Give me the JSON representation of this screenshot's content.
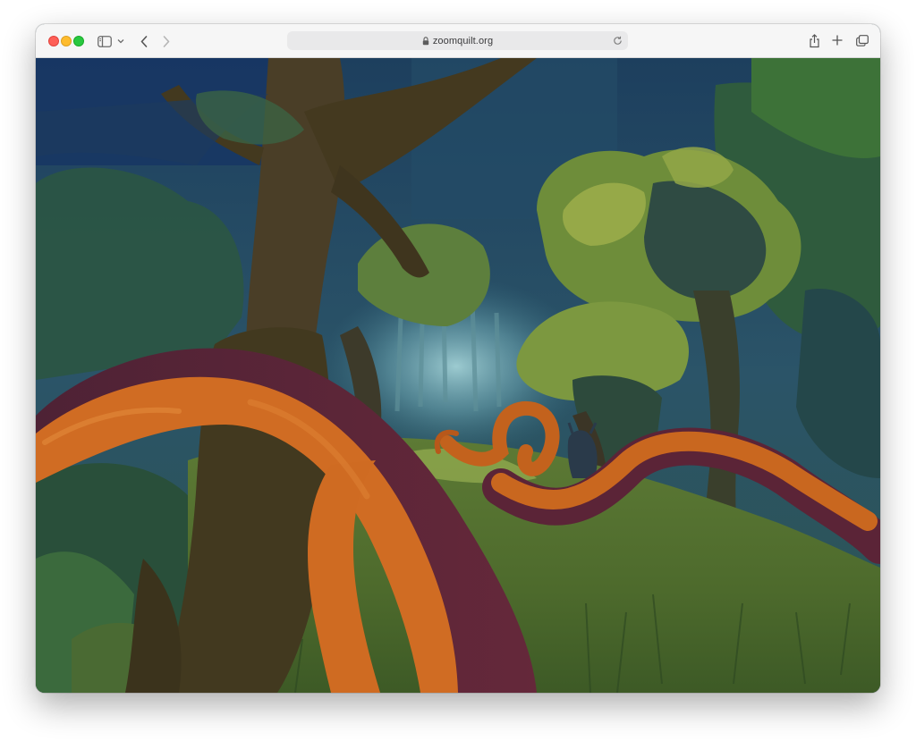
{
  "browser": {
    "url": "zoomquilt.org",
    "icons": {
      "close": "traffic-light-close",
      "minimize": "traffic-light-minimize",
      "maximize": "traffic-light-maximize",
      "sidebar": "sidebar-icon",
      "sidebar_menu": "chevron-down-icon",
      "back": "chevron-left-icon",
      "forward": "chevron-right-icon",
      "lock": "lock-icon",
      "reload": "reload-icon",
      "share": "share-icon",
      "new_tab": "plus-icon",
      "tab_overview": "tabs-icon"
    },
    "colors": {
      "close": "#fe5f57",
      "minimize": "#febc2e",
      "maximize": "#28c840"
    }
  },
  "artwork": {
    "description_colors": {
      "sky": "#1f4a63",
      "ribbon_orange": "#d06c23",
      "ribbon_shadow": "#5a2435",
      "grass": "#5c7a32"
    }
  }
}
